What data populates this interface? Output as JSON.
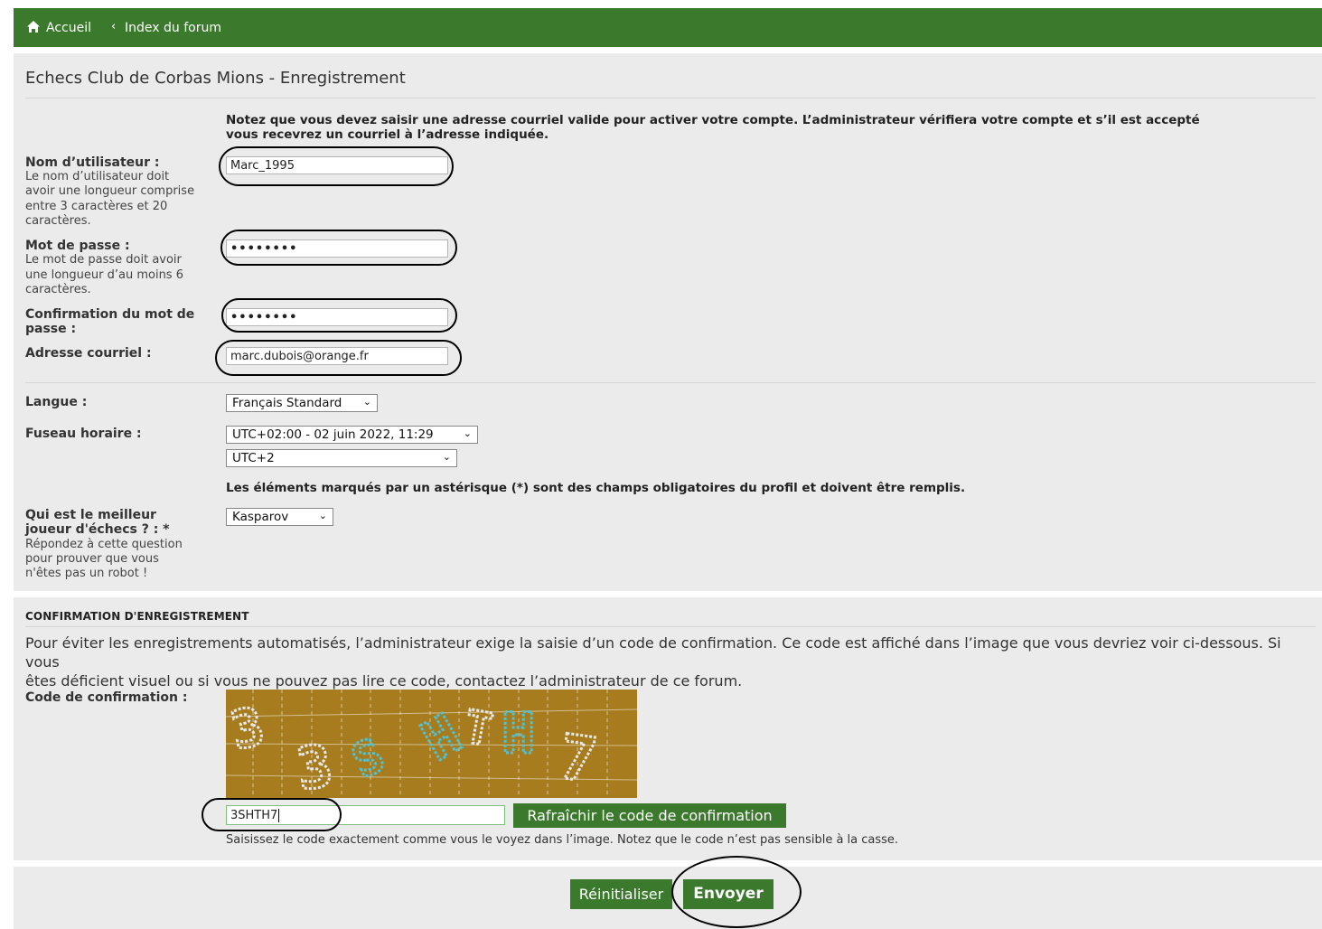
{
  "nav": {
    "home": "Accueil",
    "separator": "‹",
    "forum": "Index du forum",
    "home_icon": "home-icon"
  },
  "page_title": "Echecs Club de Corbas Mions - Enregistrement",
  "intro_note_line1": "Notez que vous devez saisir une adresse courriel valide pour activer votre compte. L’administrateur vérifiera votre compte et s’il est accepté",
  "intro_note_line2": "vous recevrez un courriel à l’adresse indiquée.",
  "username": {
    "label": "Nom d’utilisateur :",
    "hint1": "Le nom d’utilisateur doit",
    "hint2": "avoir une longueur comprise",
    "hint3": "entre 3 caractères et 20",
    "hint4": "caractères.",
    "value": "Marc_1995"
  },
  "password": {
    "label": "Mot de passe :",
    "hint1": "Le mot de passe doit avoir",
    "hint2": "une longueur d’au moins 6",
    "hint3": "caractères.",
    "value": "••••••••"
  },
  "password_confirm": {
    "label1": "Confirmation du mot de",
    "label2": "passe :",
    "value": "••••••••"
  },
  "email": {
    "label": "Adresse courriel :",
    "value": "marc.dubois@orange.fr"
  },
  "language": {
    "label": "Langue :",
    "value": "Français Standard"
  },
  "timezone": {
    "label": "Fuseau horaire :",
    "date_value": "UTC+02:00 - 02 juin 2022, 11:29",
    "zone_value": "UTC+2"
  },
  "required_note": "Les éléments marqués par un astérisque (*) sont des champs obligatoires du profil et doivent être remplis.",
  "question": {
    "label1": "Qui est le meilleur",
    "label2": "joueur d'échecs ? : *",
    "hint1": "Répondez à cette question",
    "hint2": "pour prouver que vous",
    "hint3": "n'êtes pas un robot !",
    "value": "Kasparov"
  },
  "confirmation": {
    "section_title": "CONFIRMATION D'ENREGISTREMENT",
    "paragraph_line1": "Pour éviter les enregistrements automatisés, l’administrateur exige la saisie d’un code de confirmation. Ce code est affiché dans l’image que vous devriez voir ci-dessous. Si vous",
    "paragraph_line2": "êtes déficient visuel ou si vous ne pouvez pas lire ce code, contactez l’administrateur de ce forum.",
    "code_label": "Code de confirmation :",
    "captcha_glyphs": [
      "3",
      "3",
      "S",
      "H",
      "T",
      "H",
      "7"
    ],
    "code_value": "3SHTH7",
    "refresh_label": "Rafraîchir le code de confirmation",
    "help": "Saisissez le code exactement comme vous le voyez dans l’image. Notez que le code n’est pas sensible à la casse."
  },
  "actions": {
    "reset": "Réinitialiser",
    "submit": "Envoyer"
  },
  "colors": {
    "green": "#3b7a2c",
    "panel": "#ebebeb",
    "captcha_bg": "#a67c1f"
  }
}
